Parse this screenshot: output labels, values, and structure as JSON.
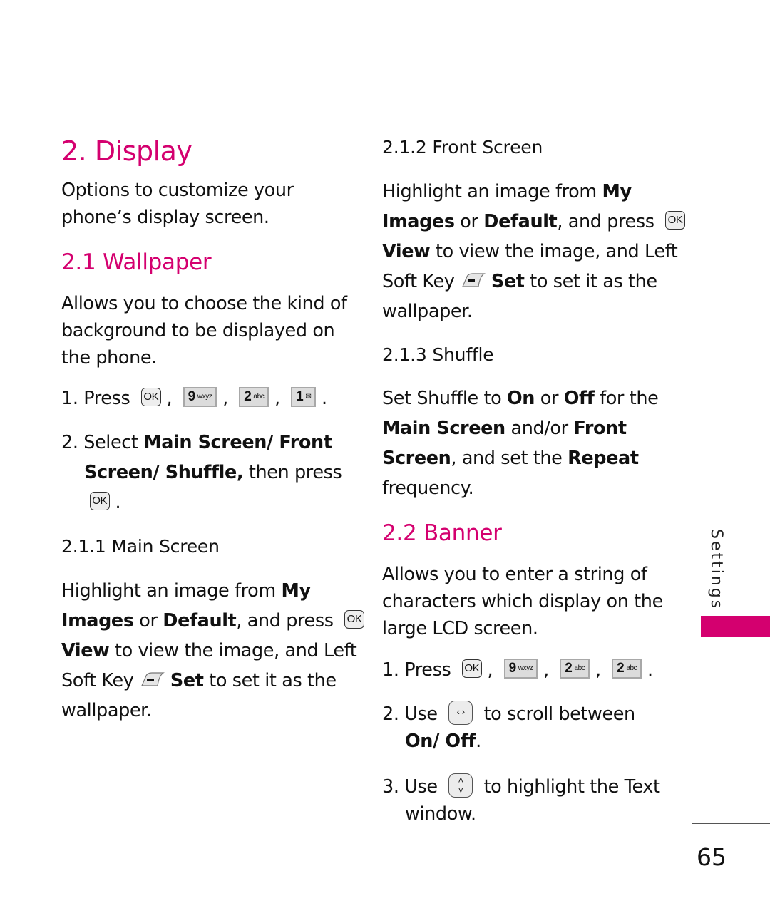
{
  "page": {
    "number": "65",
    "side_tab_label": "Settings",
    "accent_color": "#d4006f"
  },
  "left": {
    "title": "2. Display",
    "intro": [
      "Options to customize your",
      "phone’s display screen."
    ],
    "wallpaper": {
      "heading": "2.1  Wallpaper",
      "desc": [
        "Allows you to choose the kind of",
        "background to be displayed on",
        "the phone."
      ],
      "step1": {
        "prefix": "1. Press",
        "keys": [
          {
            "type": "ok",
            "label": "OK"
          },
          {
            "type": "num",
            "digit": "9",
            "sub": "wxyz"
          },
          {
            "type": "num",
            "digit": "2",
            "sub": "abc"
          },
          {
            "type": "num",
            "digit": "1",
            "sub": "voicemail"
          }
        ]
      },
      "step2": {
        "prefix": "2. Select ",
        "bold1": "Main Screen/ Front",
        "bold2": "Screen/ Shuffle,",
        "rest": " then press",
        "key": "OK",
        "end": "."
      }
    },
    "main_screen": {
      "heading": "2.1.1 Main Screen",
      "l1": "Highlight an image from ",
      "l1b": "My",
      "l2b": "Images",
      "l2": " or ",
      "l2b2": "Default",
      "l2c": ", and press",
      "ok": "OK",
      "l3b": "View",
      "l3": " to view the image, and Left",
      "l4": "Soft Key ",
      "l4b": "Set",
      "l4c": " to set it as the",
      "l5": "wallpaper."
    }
  },
  "right": {
    "front_screen": {
      "heading": "2.1.2 Front Screen",
      "l1": "Highlight an image from ",
      "l1b": "My",
      "l2b": "Images",
      "l2": " or ",
      "l2b2": "Default",
      "l2c": ", and press",
      "ok": "OK",
      "l3b": "View",
      "l3": " to view the image, and Left",
      "l4": "Soft Key ",
      "l4b": "Set",
      "l4c": " to set it as the",
      "l5": "wallpaper."
    },
    "shuffle": {
      "heading": "2.1.3 Shuffle",
      "l1": "Set Shuffle to ",
      "l1b": "On",
      "l1c": " or ",
      "l1b2": "Off",
      "l1d": " for the",
      "l2b": "Main Screen",
      "l2": " and/or ",
      "l2b2": "Front",
      "l3b": "Screen",
      "l3": ", and set the ",
      "l3b2": "Repeat",
      "l4": "frequency."
    },
    "banner": {
      "heading": "2.2  Banner",
      "desc": [
        "Allows you to enter a string of",
        "characters which display on the",
        "large LCD screen."
      ],
      "step1": {
        "prefix": "1. Press",
        "keys": [
          {
            "type": "ok",
            "label": "OK"
          },
          {
            "type": "num",
            "digit": "9",
            "sub": "wxyz"
          },
          {
            "type": "num",
            "digit": "2",
            "sub": "abc"
          },
          {
            "type": "num",
            "digit": "2",
            "sub": "abc"
          }
        ]
      },
      "step2": {
        "prefix": "2. Use",
        "rest": "to scroll between",
        "bold": "On/ Off",
        "end": "."
      },
      "step3": {
        "prefix": "3. Use",
        "rest": "to highlight the Text",
        "cont": "window."
      }
    }
  }
}
